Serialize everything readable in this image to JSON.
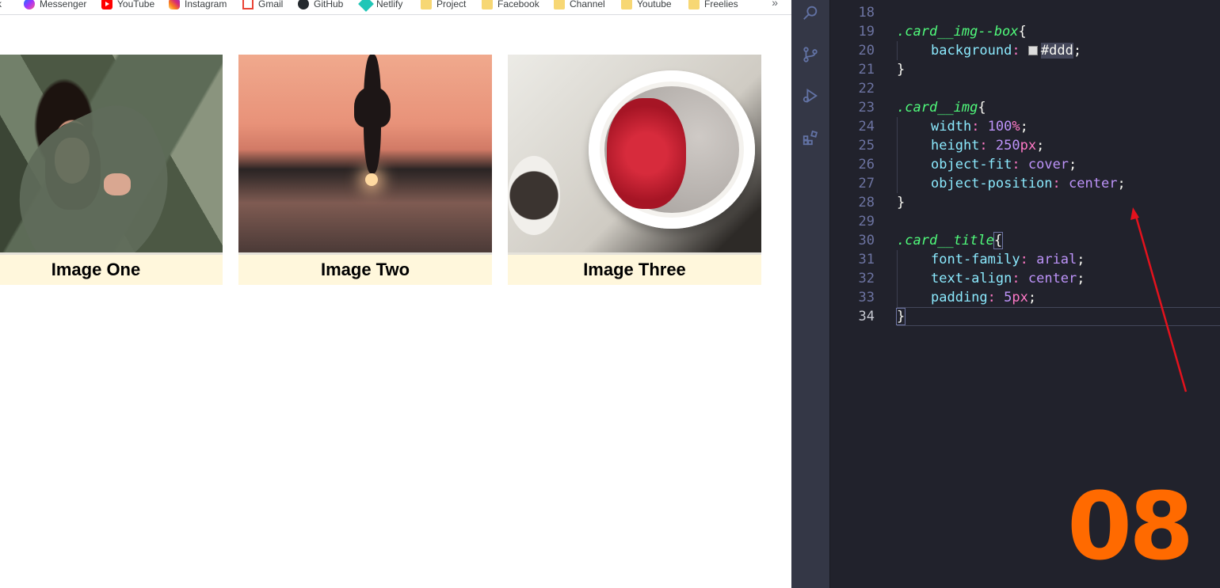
{
  "bookmarks": {
    "items": [
      {
        "label": "k",
        "icon": "none"
      },
      {
        "label": "Messenger",
        "icon": "messenger-icon"
      },
      {
        "label": "YouTube",
        "icon": "youtube-icon"
      },
      {
        "label": "Instagram",
        "icon": "instagram-icon"
      },
      {
        "label": "Gmail",
        "icon": "gmail-icon"
      },
      {
        "label": "GitHub",
        "icon": "github-icon"
      },
      {
        "label": "Netlify",
        "icon": "netlify-icon"
      },
      {
        "label": "Project",
        "icon": "folder-icon"
      },
      {
        "label": "Facebook",
        "icon": "folder-icon"
      },
      {
        "label": "Channel",
        "icon": "folder-icon"
      },
      {
        "label": "Youtube",
        "icon": "folder-icon"
      },
      {
        "label": "Freelies",
        "icon": "folder-icon"
      }
    ],
    "more": "»"
  },
  "cards": [
    {
      "title": "Image One"
    },
    {
      "title": "Image Two"
    },
    {
      "title": "Image Three"
    }
  ],
  "editor": {
    "line_numbers": [
      "18",
      "19",
      "20",
      "21",
      "22",
      "23",
      "24",
      "25",
      "26",
      "27",
      "28",
      "29",
      "30",
      "31",
      "32",
      "33",
      "34"
    ],
    "lines": {
      "l19_selector": ".card__img--box",
      "l19_brace": "{",
      "l20_prop": "background",
      "l20_colon": ":",
      "l20_value": "#ddd",
      "l20_semi": ";",
      "l21_brace": "}",
      "l23_selector": ".card__img",
      "l23_brace": "{",
      "l24_prop": "width",
      "l24_num": "100",
      "l24_unit": "%",
      "l25_prop": "height",
      "l25_num": "250",
      "l25_unit": "px",
      "l26_prop": "object-fit",
      "l26_value": "cover",
      "l27_prop": "object-position",
      "l27_value": "center",
      "l28_brace": "}",
      "l30_selector": ".card__title",
      "l30_brace": "{",
      "l31_prop": "font-family",
      "l31_value": "arial",
      "l32_prop": "text-align",
      "l32_value": "center",
      "l33_prop": "padding",
      "l33_num": "5",
      "l33_unit": "px",
      "l34_brace": "}"
    },
    "colon": ":",
    "semi": ";"
  },
  "badge": "08",
  "colors": {
    "card_bg": "#fff7dc",
    "editor_bg": "#21222c",
    "badge": "#ff6a00",
    "arrow": "#e3121d"
  }
}
